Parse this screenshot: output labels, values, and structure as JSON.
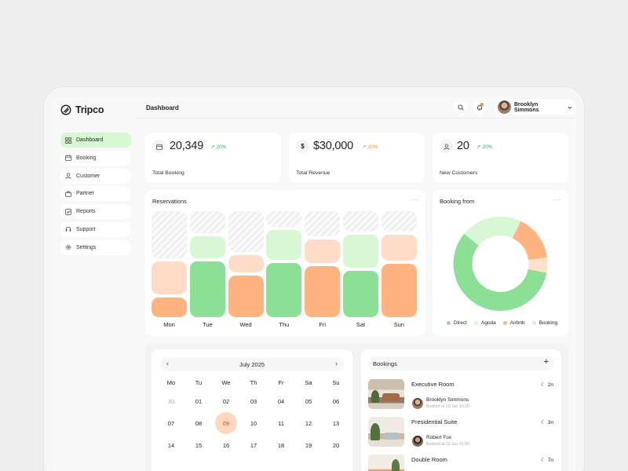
{
  "app": {
    "name": "Tripco"
  },
  "header": {
    "title": "Dashboard",
    "user_name": "Brooklyn Simmons"
  },
  "sidebar": {
    "items": [
      {
        "label": "Dashboard",
        "icon": "grid-icon",
        "active": true
      },
      {
        "label": "Booking",
        "icon": "calendar-icon"
      },
      {
        "label": "Customer",
        "icon": "user-icon"
      },
      {
        "label": "Partner",
        "icon": "briefcase-icon"
      },
      {
        "label": "Reports",
        "icon": "chart-icon"
      },
      {
        "label": "Support",
        "icon": "headset-icon"
      },
      {
        "label": "Settings",
        "icon": "gear-icon"
      }
    ]
  },
  "stats": [
    {
      "icon": "calendar-icon",
      "value": "20,349",
      "trend": "20%",
      "label": "Total Booking",
      "trend_color": "#3eaa52"
    },
    {
      "icon": "dollar-icon",
      "icon_text": "$",
      "value": "$30,000",
      "trend": "20%",
      "label": "Total Revenue",
      "trend_color": "#f08c3e"
    },
    {
      "icon": "user-icon",
      "value": "20",
      "trend": "20%",
      "label": "New Customers",
      "trend_color": "#3eaa52"
    }
  ],
  "reservations": {
    "title": "Reservations",
    "more": "···",
    "days": [
      "Mon",
      "Tue",
      "Wed",
      "Thu",
      "Fri",
      "Sat",
      "Sun"
    ]
  },
  "booking_from": {
    "title": "Booking from",
    "more": "···",
    "legend": [
      {
        "label": "Direct",
        "color": "#8ce095"
      },
      {
        "label": "Agoda",
        "color": "#d7f8d3"
      },
      {
        "label": "Airbnb",
        "color": "#ffb47f"
      },
      {
        "label": "Booking",
        "color": "#ffe1cc"
      }
    ]
  },
  "calendar": {
    "month": "July 2025",
    "prev": "‹",
    "next": "›",
    "weekdays": [
      "Mo",
      "Tu",
      "We",
      "Th",
      "Fr",
      "Sa",
      "Su"
    ],
    "weeks": [
      [
        "30",
        "01",
        "02",
        "03",
        "04",
        "05",
        "06"
      ],
      [
        "07",
        "08",
        "09",
        "10",
        "11",
        "12",
        "13"
      ],
      [
        "14",
        "15",
        "16",
        "17",
        "18",
        "19",
        "20"
      ]
    ],
    "selected": "09",
    "muted": [
      "30"
    ]
  },
  "bookings": {
    "title": "Bookings",
    "add": "+",
    "items": [
      {
        "room": "Executive Room",
        "nights": "2n",
        "guest": "Brooklyn Simmons",
        "date": "Booked at 10 Jun 10:30"
      },
      {
        "room": "Presidential Suite",
        "nights": "3n",
        "guest": "Robert Fox",
        "date": "Booked at 12 Jun 01:00"
      },
      {
        "room": "Double Room",
        "nights": "7n",
        "guest": "",
        "date": ""
      }
    ]
  },
  "chart_data": [
    {
      "type": "bar",
      "title": "Reservations",
      "categories": [
        "Mon",
        "Tue",
        "Wed",
        "Thu",
        "Fri",
        "Sat",
        "Sun"
      ],
      "series": [
        {
          "name": "",
          "values": [
            20,
            55,
            40,
            55,
            50,
            45,
            55
          ],
          "color": "green-or-orange"
        }
      ],
      "note_colors": {
        "green": "#8ce095",
        "light_green": "#d7f8d3",
        "orange": "#ffb47f",
        "light_orange": "#ffdcc7"
      }
    },
    {
      "type": "pie",
      "title": "Booking from",
      "categories": [
        "Direct",
        "Agoda",
        "Airbnb",
        "Booking"
      ],
      "values": [
        55,
        20,
        15,
        5
      ]
    }
  ]
}
